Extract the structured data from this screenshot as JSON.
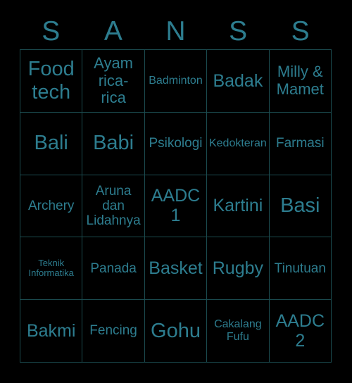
{
  "card": {
    "background_color": "#000000",
    "text_color": "#2d7d8f",
    "grid_line_color": "#1b4b4f",
    "columns": 5,
    "rows": 5
  },
  "header": {
    "title": "SANSS",
    "letters": [
      {
        "label": "S"
      },
      {
        "label": "A"
      },
      {
        "label": "N"
      },
      {
        "label": "S"
      },
      {
        "label": "S"
      }
    ]
  },
  "grid": {
    "cells": [
      {
        "text": "Food\ntech",
        "size": "xxl"
      },
      {
        "text": "Ayam\nrica-\nrica",
        "size": "lg"
      },
      {
        "text": "Badminton",
        "size": "sm"
      },
      {
        "text": "Badak",
        "size": "xl"
      },
      {
        "text": "Milly &\nMamet",
        "size": "lg"
      },
      {
        "text": "Bali",
        "size": "xxl"
      },
      {
        "text": "Babi",
        "size": "xxl"
      },
      {
        "text": "Psikologi",
        "size": "md"
      },
      {
        "text": "Kedokteran",
        "size": "sm"
      },
      {
        "text": "Farmasi",
        "size": "md"
      },
      {
        "text": "Archery",
        "size": "md"
      },
      {
        "text": "Aruna\ndan\nLidahnya",
        "size": "md"
      },
      {
        "text": "AADC\n1",
        "size": "xl"
      },
      {
        "text": "Kartini",
        "size": "xl"
      },
      {
        "text": "Basi",
        "size": "xxl"
      },
      {
        "text": "Teknik\nInformatika",
        "size": "xs"
      },
      {
        "text": "Panada",
        "size": "md"
      },
      {
        "text": "Basket",
        "size": "xl"
      },
      {
        "text": "Rugby",
        "size": "xl"
      },
      {
        "text": "Tinutuan",
        "size": "md"
      },
      {
        "text": "Bakmi",
        "size": "xl"
      },
      {
        "text": "Fencing",
        "size": "md"
      },
      {
        "text": "Gohu",
        "size": "xxl"
      },
      {
        "text": "Cakalang\nFufu",
        "size": "sm"
      },
      {
        "text": "AADC\n2",
        "size": "xl"
      }
    ]
  }
}
